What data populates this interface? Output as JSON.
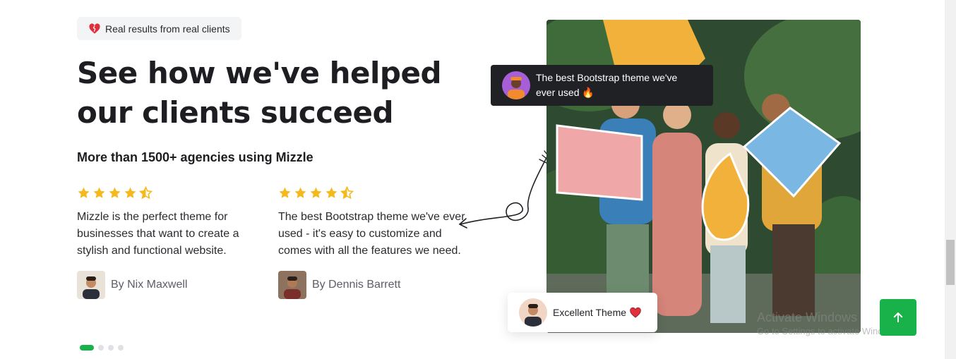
{
  "badge": {
    "text": "Real results from real clients"
  },
  "heading": {
    "title": "See how we've helped our clients succeed"
  },
  "subheading": {
    "text": "More than 1500+ agencies using Mizzle"
  },
  "reviews": [
    {
      "rating": 4.5,
      "text": "Mizzle is the perfect theme for businesses that want to create a stylish and functional website.",
      "author": "By Nix Maxwell"
    },
    {
      "rating": 4.5,
      "text": "The best Bootstrap theme we've ever used - it's easy to customize and comes with all the features we need.",
      "author": "By Dennis Barrett"
    }
  ],
  "carousel": {
    "total_slides": 4,
    "active_index": 0
  },
  "tooltips": {
    "dark": {
      "text": "The best Bootstrap theme we've ever used",
      "emoji": "🔥"
    },
    "light": {
      "text": "Excellent Theme",
      "emoji": "❤️"
    }
  },
  "watermark": {
    "title": "Activate Windows",
    "subtitle": "Go to Settings to activate Windows."
  },
  "colors": {
    "accent_green": "#19b24a",
    "star_yellow": "#f5b91e",
    "heading_dark": "#1d1d22",
    "tooltip_dark_bg": "#1f2125"
  },
  "icons": {
    "badge_icon": "broken-heart-icon",
    "star": "star-icon",
    "to_top": "arrow-up-icon"
  }
}
